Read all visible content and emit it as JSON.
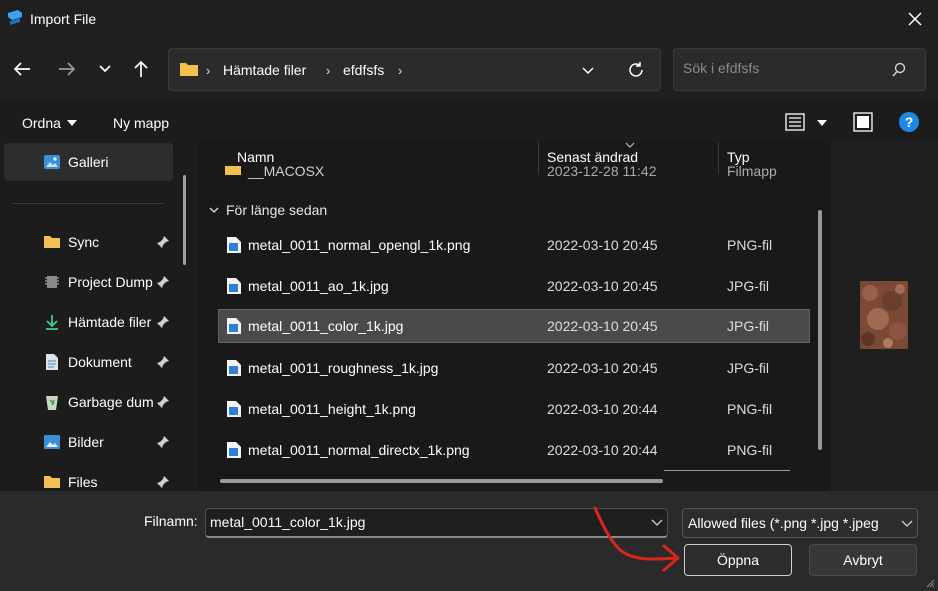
{
  "window": {
    "title": "Import File"
  },
  "nav": {
    "breadcrumb": [
      "Hämtade filer",
      "efdfsfs"
    ],
    "search_placeholder": "Sök i efdfsfs"
  },
  "toolbar": {
    "organize_label": "Ordna",
    "new_folder_label": "Ny mapp"
  },
  "sidebar": {
    "gallery_label": "Galleri",
    "items": [
      {
        "label": "Sync",
        "icon": "folder-icon"
      },
      {
        "label": "Project Dump",
        "icon": "chip-icon"
      },
      {
        "label": "Hämtade filer",
        "icon": "download-icon"
      },
      {
        "label": "Dokument",
        "icon": "document-icon"
      },
      {
        "label": "Garbage dump",
        "icon": "recycle-bin-icon"
      },
      {
        "label": "Bilder",
        "icon": "pictures-icon"
      },
      {
        "label": "Files",
        "icon": "folder-icon"
      }
    ]
  },
  "filelist": {
    "columns": {
      "name": "Namn",
      "date": "Senast ändrad",
      "type": "Typ"
    },
    "partial_row": {
      "name": "__MACOSX",
      "date": "2023-12-28 11:42",
      "type": "Filmapp"
    },
    "group_label": "För länge sedan",
    "files": [
      {
        "name": "metal_0011_normal_opengl_1k.png",
        "date": "2022-03-10 20:45",
        "type": "PNG-fil",
        "selected": false
      },
      {
        "name": "metal_0011_ao_1k.jpg",
        "date": "2022-03-10 20:45",
        "type": "JPG-fil",
        "selected": false
      },
      {
        "name": "metal_0011_color_1k.jpg",
        "date": "2022-03-10 20:45",
        "type": "JPG-fil",
        "selected": true
      },
      {
        "name": "metal_0011_roughness_1k.jpg",
        "date": "2022-03-10 20:45",
        "type": "JPG-fil",
        "selected": false
      },
      {
        "name": "metal_0011_height_1k.png",
        "date": "2022-03-10 20:44",
        "type": "PNG-fil",
        "selected": false
      },
      {
        "name": "metal_0011_normal_directx_1k.png",
        "date": "2022-03-10 20:44",
        "type": "PNG-fil",
        "selected": false
      }
    ]
  },
  "footer": {
    "filename_label": "Filnamn:",
    "filename_value": "metal_0011_color_1k.jpg",
    "filetype_value": "Allowed files (*.png *.jpg *.jpeg",
    "open_label": "Öppna",
    "cancel_label": "Avbryt"
  },
  "colors": {
    "selection": "#4a4a4a",
    "help_blue": "#1e88e5",
    "annotation_red": "#d9261c",
    "folder_yellow": "#f2c14e"
  }
}
